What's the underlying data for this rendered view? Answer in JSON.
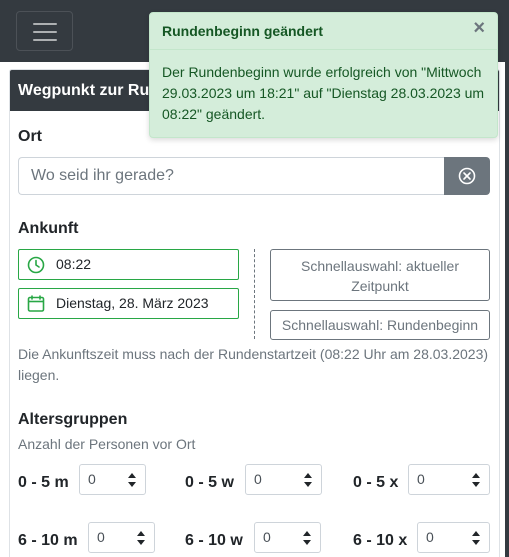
{
  "header": {
    "card_title": "Wegpunkt zur Ru"
  },
  "location": {
    "label": "Ort",
    "placeholder": "Wo seid ihr gerade?"
  },
  "arrival": {
    "label": "Ankunft",
    "time_value": "08:22",
    "date_value": "Dienstag, 28. März 2023",
    "quick_now_label": "Schnellauswahl: aktueller Zeitpunkt",
    "quick_round_label": "Schnellauswahl: Rundenbeginn",
    "helper_text": "Die Ankunftszeit muss nach der Rundenstartzeit (08:22 Uhr am 28.03.2023) liegen."
  },
  "age_groups": {
    "label": "Altersgruppen",
    "helper": "Anzahl der Personen vor Ort",
    "rows": [
      [
        {
          "label": "0 - 5 m",
          "value": "0"
        },
        {
          "label": "0 - 5 w",
          "value": "0"
        },
        {
          "label": "0 - 5 x",
          "value": "0"
        }
      ],
      [
        {
          "label": "6 - 10 m",
          "value": "0"
        },
        {
          "label": "6 - 10 w",
          "value": "0"
        },
        {
          "label": "6 - 10 x",
          "value": "0"
        }
      ]
    ]
  },
  "toast": {
    "title": "Rundenbeginn geändert",
    "close": "×",
    "message": "Der Rundenbeginn wurde erfolgreich von \"Mittwoch 29.03.2023 um 18:21\" auf \"Dienstag 28.03.2023 um 08:22\" geändert."
  },
  "colors": {
    "navbar": "#343a40",
    "success_border": "#28a745",
    "toast_bg": "#d4edda",
    "toast_text": "#155724",
    "secondary": "#6c757d"
  },
  "icons": {
    "menu": "hamburger-icon",
    "clear": "clear-circle-x-icon",
    "time": "clock-icon",
    "date": "calendar-icon",
    "close": "close-icon"
  }
}
